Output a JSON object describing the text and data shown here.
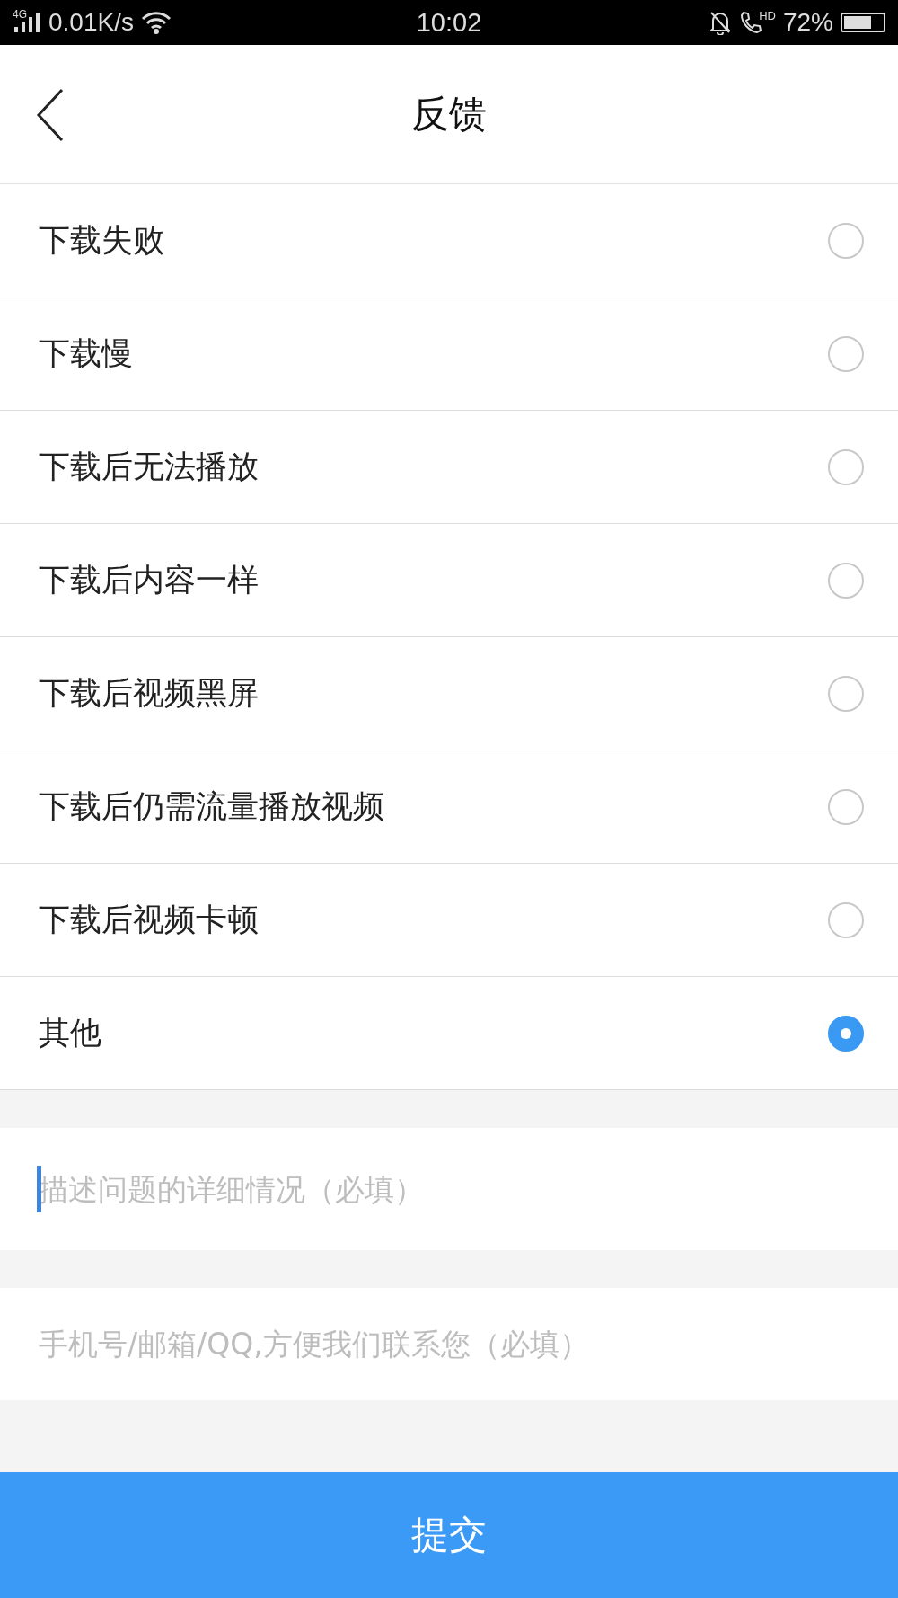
{
  "status_bar": {
    "network": "4G",
    "speed": "0.01K/s",
    "time": "10:02",
    "call_badge": "HD",
    "battery": "72%"
  },
  "header": {
    "title": "反馈"
  },
  "options": [
    {
      "label": "下载失败",
      "selected": false
    },
    {
      "label": "下载慢",
      "selected": false
    },
    {
      "label": "下载后无法播放",
      "selected": false
    },
    {
      "label": "下载后内容一样",
      "selected": false
    },
    {
      "label": "下载后视频黑屏",
      "selected": false
    },
    {
      "label": "下载后仍需流量播放视频",
      "selected": false
    },
    {
      "label": "下载后视频卡顿",
      "selected": false
    },
    {
      "label": "其他",
      "selected": true
    }
  ],
  "fields": [
    {
      "placeholder": "描述问题的详细情况（必填）",
      "focused": true
    },
    {
      "placeholder": "手机号/邮箱/QQ,方便我们联系您（必填）",
      "focused": false
    }
  ],
  "submit": "提交"
}
